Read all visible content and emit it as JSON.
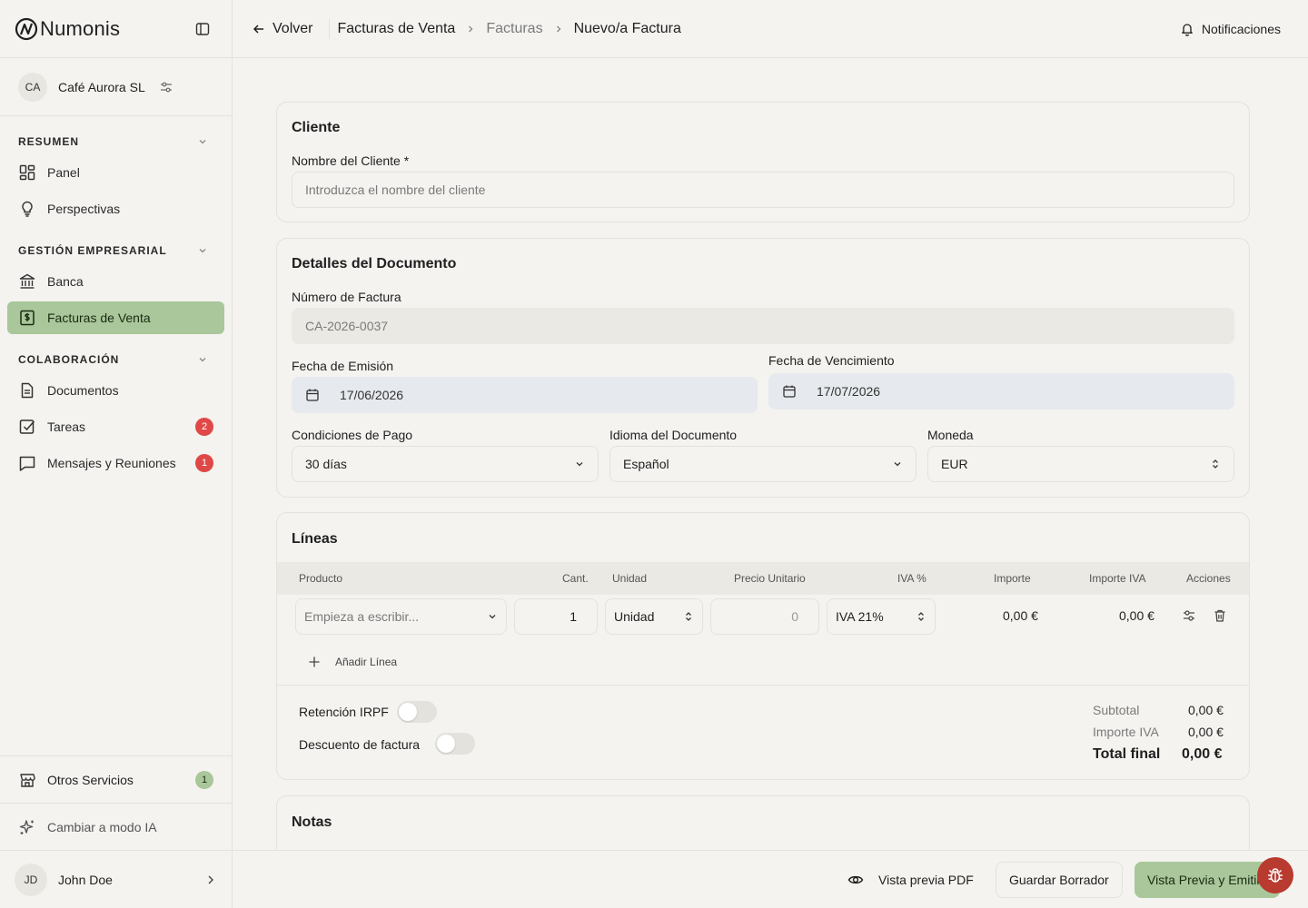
{
  "brand": {
    "name": "Numonis"
  },
  "org": {
    "initials": "CA",
    "name": "Café Aurora SL"
  },
  "sidebar": {
    "sections": [
      {
        "title": "RESUMEN",
        "items": [
          {
            "label": "Panel",
            "icon": "dashboard-icon"
          },
          {
            "label": "Perspectivas",
            "icon": "lightbulb-icon"
          }
        ]
      },
      {
        "title": "GESTIÓN EMPRESARIAL",
        "items": [
          {
            "label": "Banca",
            "icon": "bank-icon"
          },
          {
            "label": "Facturas de Venta",
            "icon": "invoice-icon",
            "active": true
          }
        ]
      },
      {
        "title": "COLABORACIÓN",
        "items": [
          {
            "label": "Documentos",
            "icon": "document-icon"
          },
          {
            "label": "Tareas",
            "icon": "checkbox-icon",
            "badge": "2"
          },
          {
            "label": "Mensajes y Reuniones",
            "icon": "message-icon",
            "badge": "1"
          }
        ]
      }
    ],
    "other_services": {
      "label": "Otros Servicios",
      "badge": "1"
    },
    "ai_mode": {
      "label": "Cambiar a modo IA"
    },
    "user": {
      "initials": "JD",
      "name": "John Doe"
    }
  },
  "topbar": {
    "back_label": "Volver",
    "breadcrumbs": [
      "Facturas de Venta",
      "Facturas",
      "Nuevo/a Factura"
    ],
    "notifications_label": "Notificaciones"
  },
  "client": {
    "title": "Cliente",
    "name_label": "Nombre del Cliente *",
    "name_placeholder": "Introduzca el nombre del cliente"
  },
  "details": {
    "title": "Detalles del Documento",
    "number_label": "Número de Factura",
    "number_value": "CA-2026-0037",
    "issue_label": "Fecha de Emisión",
    "issue_value": "17/06/2026",
    "due_label": "Fecha de Vencimiento",
    "due_value": "17/07/2026",
    "terms_label": "Condiciones de Pago",
    "terms_value": "30 días",
    "language_label": "Idioma del Documento",
    "language_value": "Español",
    "currency_label": "Moneda",
    "currency_value": "EUR"
  },
  "lines": {
    "title": "Líneas",
    "columns": [
      "Producto",
      "Cant.",
      "Unidad",
      "Precio Unitario",
      "IVA %",
      "Importe",
      "Importe IVA",
      "Acciones"
    ],
    "row": {
      "product_placeholder": "Empieza a escribir...",
      "quantity": "1",
      "unit": "Unidad",
      "unit_price": "0",
      "vat": "IVA 21%",
      "amount": "0,00 €",
      "vat_amount": "0,00 €"
    },
    "add_line_label": "Añadir Línea",
    "irpf_label": "Retención IRPF",
    "discount_label": "Descuento de factura",
    "subtotal_label": "Subtotal",
    "subtotal_value": "0,00 €",
    "vat_total_label": "Importe IVA",
    "vat_total_value": "0,00 €",
    "total_label": "Total final",
    "total_value": "0,00 €"
  },
  "notes": {
    "title": "Notas"
  },
  "footer": {
    "preview_pdf_label": "Vista previa PDF",
    "save_draft_label": "Guardar Borrador",
    "preview_issue_label": "Vista Previa y Emitir"
  }
}
